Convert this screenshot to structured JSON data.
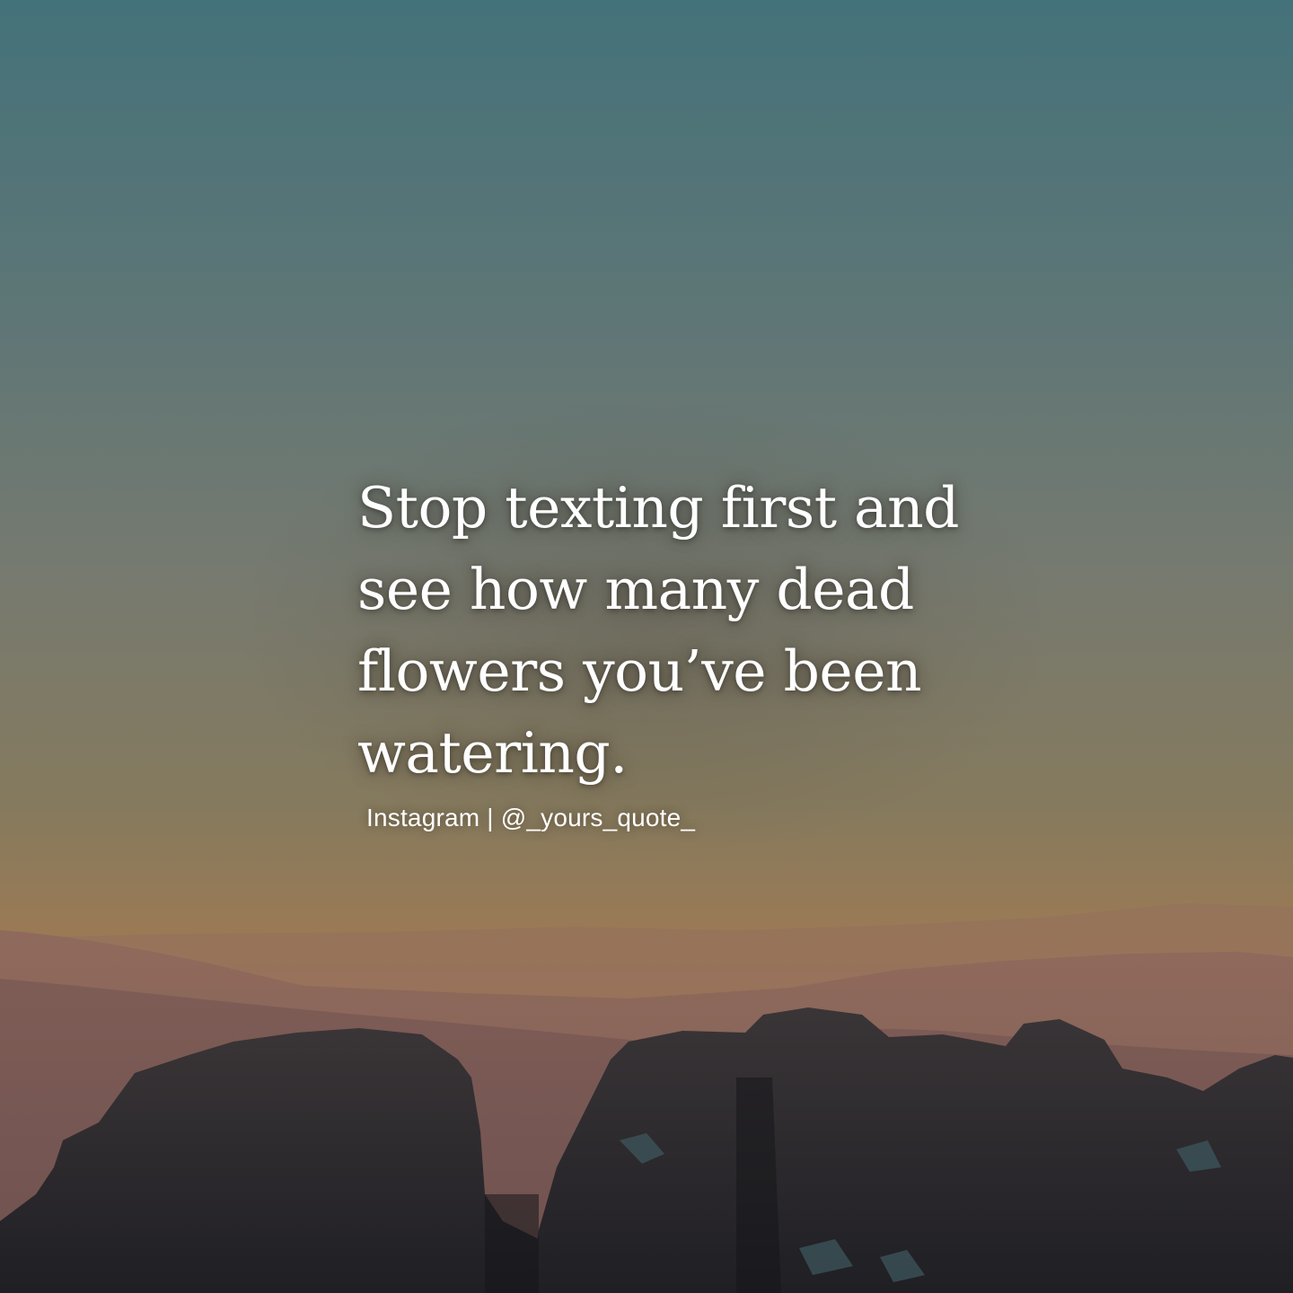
{
  "quote": {
    "lines": [
      "Stop texting first and",
      "see how many dead",
      "flowers you’ve been",
      "watering."
    ]
  },
  "credit": {
    "text": "Instagram | @_yours_quote_"
  },
  "colors": {
    "sky_top": "#4a7477",
    "sky_mid": "#7a7b6e",
    "horizon_glow": "#a37a52",
    "far_hills": "#8a6458",
    "rocks": "#2c2a2c",
    "text": "#ffffff"
  }
}
